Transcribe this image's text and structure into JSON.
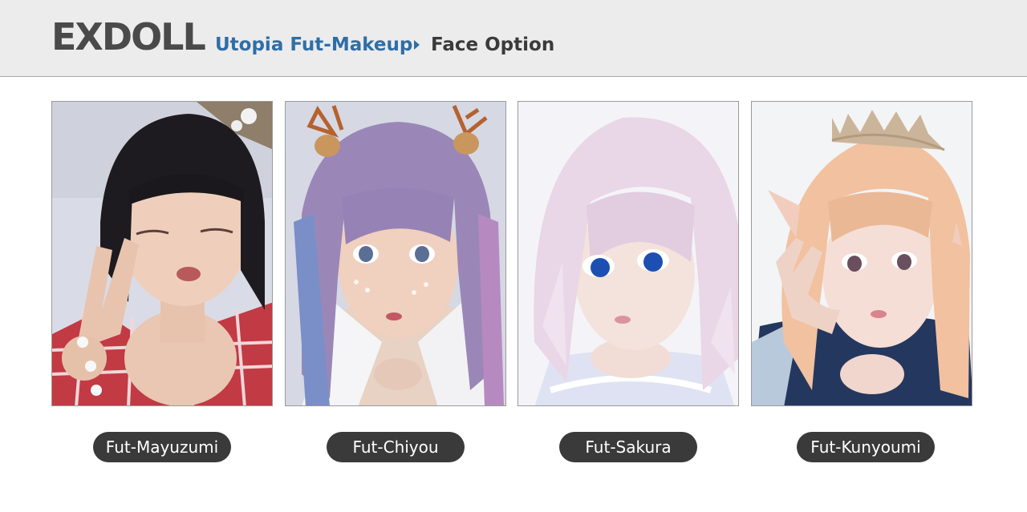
{
  "header": {
    "logo": "EXDOLL",
    "breadcrumb_link": "Utopia Fut-Makeup",
    "breadcrumb_current": "Face Option"
  },
  "colors": {
    "header_bg": "#ececec",
    "link": "#2f6ea6",
    "label_bg": "#3a3a3a"
  },
  "faces": [
    {
      "name": "Fut-Mayuzumi",
      "hair": "black",
      "outfit": "red gingham"
    },
    {
      "name": "Fut-Chiyou",
      "hair": "purple twin-tails",
      "outfit": "white shirt"
    },
    {
      "name": "Fut-Sakura",
      "hair": "pale pink",
      "outfit": "white"
    },
    {
      "name": "Fut-Kunyoumi",
      "hair": "peach blonde",
      "outfit": "navy"
    }
  ]
}
